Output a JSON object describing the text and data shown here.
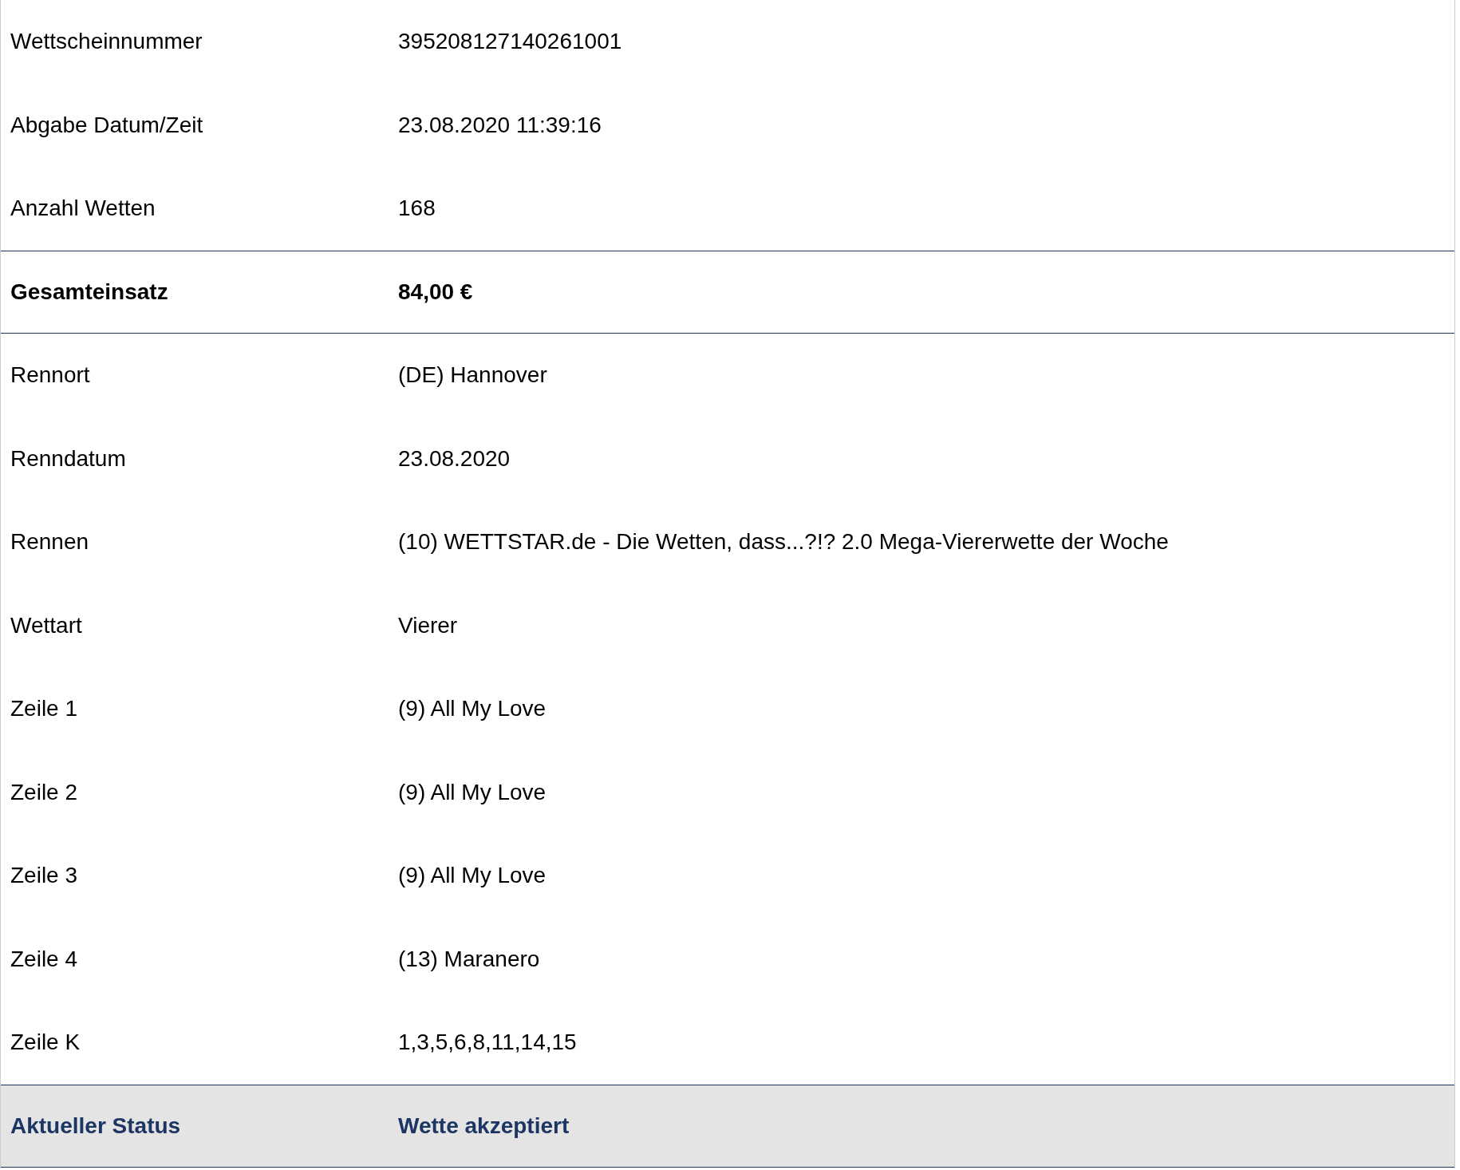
{
  "rows": [
    {
      "kind": "normal",
      "label": "Wettscheinnummer",
      "value": "395208127140261001"
    },
    {
      "kind": "normal",
      "label": "Abgabe Datum/Zeit",
      "value": "23.08.2020 11:39:16"
    },
    {
      "kind": "normal",
      "label": "Anzahl Wetten",
      "value": "168"
    },
    {
      "kind": "total",
      "label": "Gesamteinsatz",
      "value": "84,00 €"
    },
    {
      "kind": "normal",
      "label": "Rennort",
      "value": "(DE) Hannover"
    },
    {
      "kind": "normal",
      "label": "Renndatum",
      "value": "23.08.2020"
    },
    {
      "kind": "normal",
      "label": "Rennen",
      "value": "(10) WETTSTAR.de - Die Wetten, dass...?!? 2.0 Mega-Viererwette der Woche"
    },
    {
      "kind": "normal",
      "label": "Wettart",
      "value": "Vierer"
    },
    {
      "kind": "normal",
      "label": "Zeile 1",
      "value": "(9) All My Love"
    },
    {
      "kind": "normal",
      "label": "Zeile 2",
      "value": "(9) All My Love"
    },
    {
      "kind": "normal",
      "label": "Zeile 3",
      "value": "(9) All My Love"
    },
    {
      "kind": "normal",
      "label": "Zeile 4",
      "value": "(13) Maranero"
    },
    {
      "kind": "normal",
      "label": "Zeile K",
      "value": "1,3,5,6,8,11,14,15"
    },
    {
      "kind": "status",
      "label": "Aktueller Status",
      "value": "Wette akzeptiert"
    }
  ]
}
